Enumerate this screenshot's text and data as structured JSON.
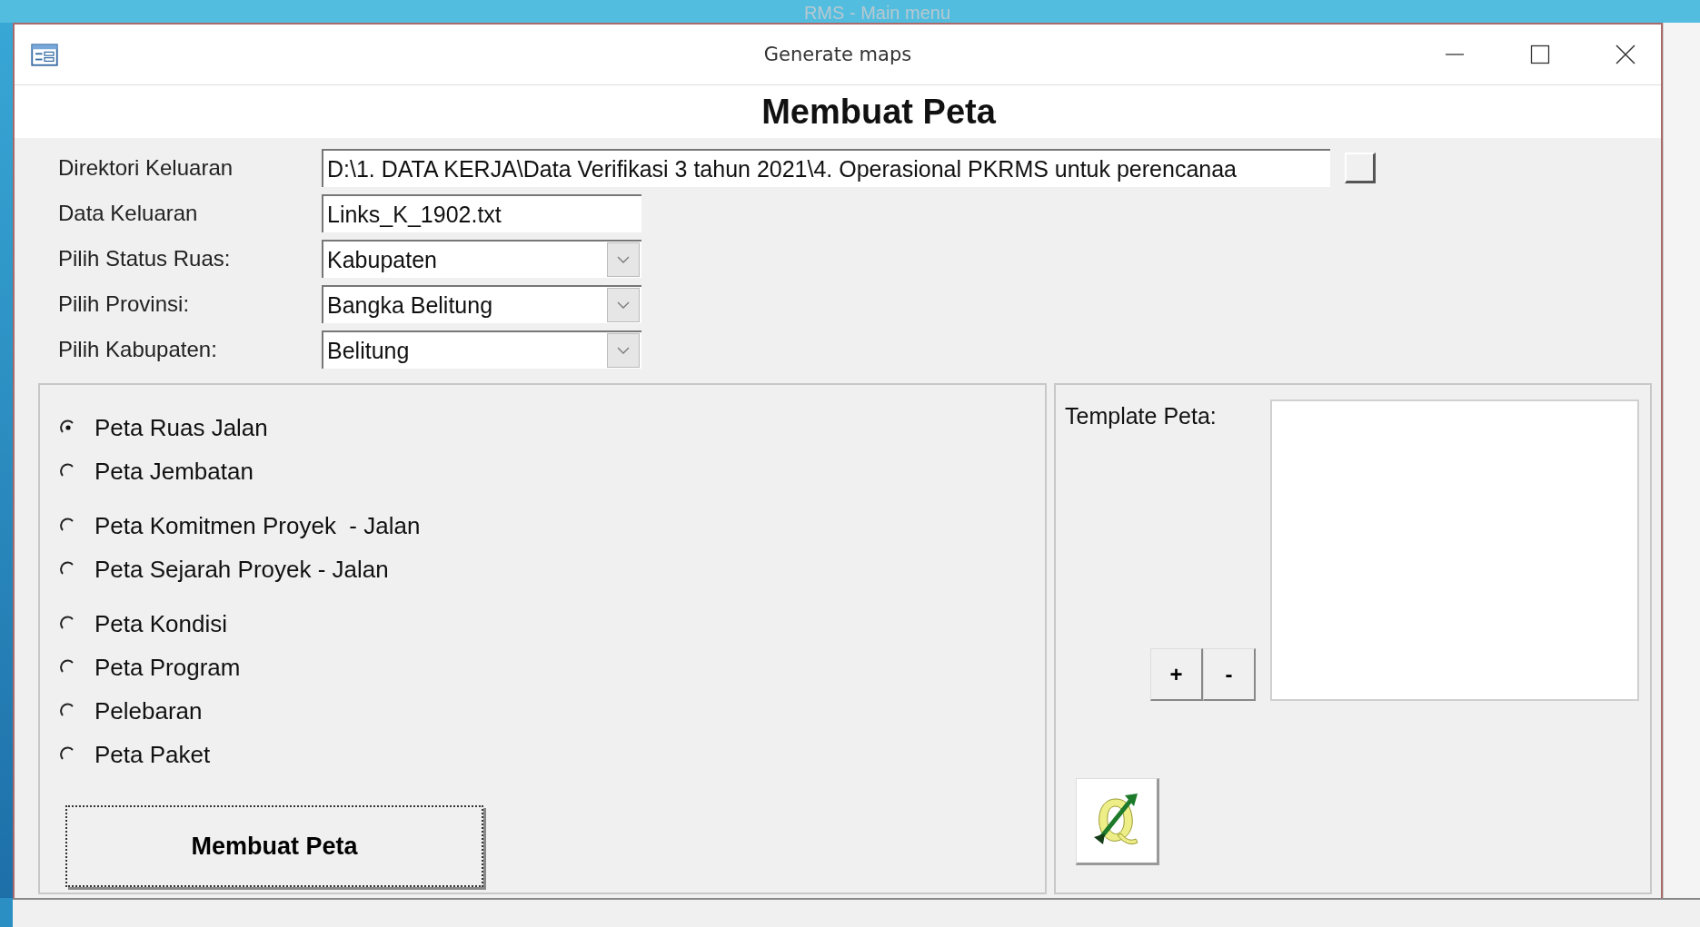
{
  "background_window": {
    "title": "RMS - Main menu"
  },
  "window": {
    "title": "Generate maps"
  },
  "header": "Membuat Peta",
  "fields": [
    {
      "kind": "path",
      "label": "Direktori Keluaran",
      "value": "D:\\1. DATA KERJA\\Data Verifikasi 3 tahun 2021\\4. Operasional PKRMS untuk perencanaa"
    },
    {
      "kind": "text",
      "label": "Data Keluaran",
      "value": "Links_K_1902.txt"
    },
    {
      "kind": "dropdown",
      "label": "Pilih Status Ruas:",
      "value": "Kabupaten"
    },
    {
      "kind": "dropdown",
      "label": "Pilih Provinsi:",
      "value": "Bangka Belitung"
    },
    {
      "kind": "dropdown",
      "label": "Pilih Kabupaten:",
      "value": "Belitung"
    }
  ],
  "map_type_groups": [
    [
      {
        "label": "Peta Ruas Jalan",
        "selected": true
      },
      {
        "label": "Peta Jembatan",
        "selected": false
      }
    ],
    [
      {
        "label": "Peta Komitmen Proyek  - Jalan",
        "selected": false
      },
      {
        "label": "Peta Sejarah Proyek - Jalan",
        "selected": false
      }
    ],
    [
      {
        "label": "Peta Kondisi",
        "selected": false
      },
      {
        "label": "Peta Program",
        "selected": false
      },
      {
        "label": "Pelebaran",
        "selected": false
      },
      {
        "label": "Peta Paket",
        "selected": false
      }
    ]
  ],
  "action_button": "Membuat Peta",
  "template": {
    "label": "Template Peta:",
    "add": "+",
    "remove": "-"
  }
}
